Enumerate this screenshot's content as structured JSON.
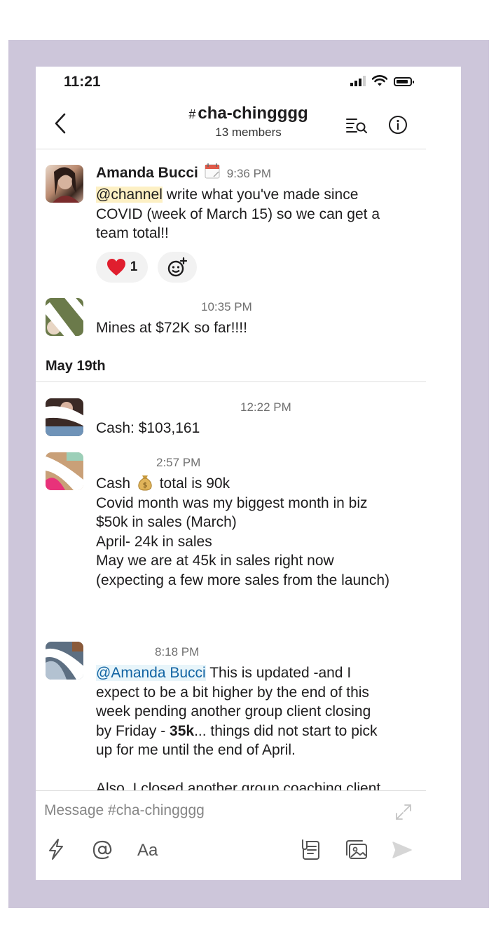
{
  "status_bar": {
    "time": "11:21"
  },
  "header": {
    "hash": "#",
    "channel_name": "cha-chingggg",
    "member_count": "13 members"
  },
  "messages": [
    {
      "author": "Amanda Bucci",
      "time": "9:36 PM",
      "mention": "@channel",
      "lines": [
        "write what you've made since",
        "COVID (week of March 15) so we can get a",
        "team total!!"
      ],
      "reactions": [
        {
          "emoji": "heart",
          "count": "1"
        }
      ]
    },
    {
      "author": "",
      "time": "10:35 PM",
      "lines": [
        "Mines at $72K so far!!!!"
      ]
    }
  ],
  "day_divider": "May 19th",
  "messages2": [
    {
      "author": "",
      "time": "12:22 PM",
      "lines": [
        "Cash: $103,161"
      ]
    },
    {
      "author": "",
      "time": "2:57 PM",
      "lines": [
        "Cash",
        "total is 90k",
        "Covid month was my biggest month in biz",
        "$50k in sales (March)",
        "April- 24k in sales",
        "May we are at 45k in sales right now",
        "(expecting a few more sales from the launch)"
      ]
    },
    {
      "author": "",
      "time": "8:18 PM",
      "mention": "@Amanda Bucci",
      "lines": [
        "This is updated -and I",
        "expect to be a bit higher by the end of this",
        "week pending another group client closing",
        "by Friday -",
        "35k",
        "... things did not start to pick",
        "up for me until the end of April.",
        "Also, I closed another group coaching client"
      ]
    }
  ],
  "composer": {
    "placeholder": "Message #cha-chingggg",
    "format_label": "Aa"
  },
  "colors": {
    "frame": "#cdc6da",
    "mention_bg": "#fdf0c4",
    "link": "#1264a3"
  }
}
